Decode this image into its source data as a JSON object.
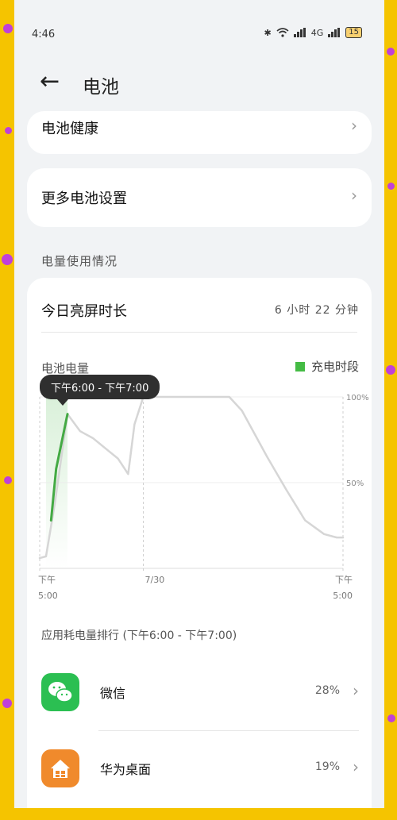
{
  "status": {
    "time": "4:46",
    "network": "4G",
    "battery": "15"
  },
  "header": {
    "title": "电池"
  },
  "rows": {
    "health": "电池健康",
    "more": "更多电池设置"
  },
  "usage": {
    "section": "电量使用情况",
    "screen_label": "今日亮屏时长",
    "screen_value": "6 小时 22 分钟",
    "chart_title": "电池电量",
    "legend_label": "充电时段",
    "tooltip": "下午6:00 - 下午7:00",
    "rank_title": "应用耗电量排行 (下午6:00 - 下午7:00)"
  },
  "chart_data": {
    "type": "line",
    "title": "电池电量",
    "y_tick_labels": [
      "100%",
      "50%"
    ],
    "x_tick_labels": [
      {
        "line1": "下午",
        "line2": "5:00"
      },
      {
        "line1": "7/30",
        "line2": ""
      },
      {
        "line1": "下午",
        "line2": "5:00"
      }
    ],
    "ylim": [
      0,
      100
    ],
    "xlim": [
      0,
      24
    ],
    "series": [
      {
        "name": "电池电量",
        "x": [
          0,
          0.5,
          1.2,
          2.2,
          3.2,
          4.2,
          5.2,
          6.2,
          7,
          7.5,
          8.2,
          9,
          11,
          13,
          14,
          15,
          16,
          18,
          19.5,
          21,
          22.5,
          23.5,
          24
        ],
        "y": [
          6,
          7,
          38,
          90,
          80,
          76,
          70,
          64,
          55,
          84,
          100,
          100,
          100,
          100,
          100,
          100,
          92,
          65,
          46,
          28,
          20,
          18,
          18
        ]
      }
    ],
    "charging_series": {
      "name": "充电时段",
      "x": [
        0.9,
        1.3,
        2.2
      ],
      "y": [
        28,
        58,
        90
      ]
    },
    "charging_highlight": [
      0.5,
      2.2
    ],
    "colors": {
      "line": "#d6d6d6",
      "charge": "#44aa44"
    },
    "grid": true
  },
  "apps": [
    {
      "name": "微信",
      "pct": "28%",
      "icon": "wechat-icon",
      "color": "#2bbf52"
    },
    {
      "name": "华为桌面",
      "pct": "19%",
      "icon": "home-icon",
      "color": "#f08a2c"
    }
  ]
}
